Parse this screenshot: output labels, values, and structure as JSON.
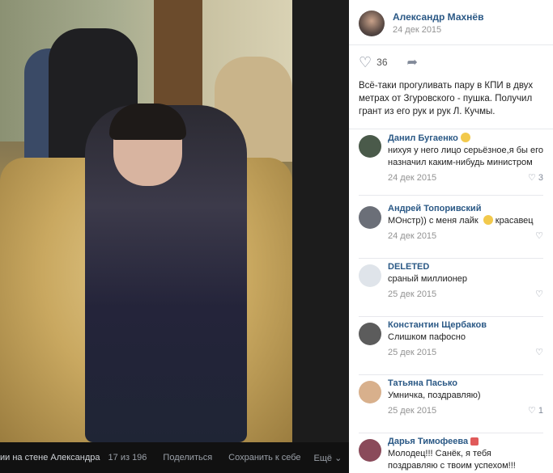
{
  "viewer": {
    "album_label": "ии на стене Александра",
    "counter": "17 из 196",
    "share_label": "Поделиться",
    "save_label": "Сохранить к себе",
    "more_label": "Ещё ⌄"
  },
  "post": {
    "author_name": "Александр Махнёв",
    "date": "24 дек 2015",
    "likes_count": "36",
    "text": "Всё-таки прогуливать пару в КПИ в двух метрах от Згуровского - пушка. Получил грант из его рук и рук Л. Кучмы."
  },
  "comments": [
    {
      "name": "Данил Бугаенко",
      "emoji": "sunglasses-emoji",
      "text": "нихуя у него лицо серьёзное,я бы его назначил каким-нибудь министром",
      "date": "24 дек 2015",
      "likes": "3"
    },
    {
      "name": "Андрей Топоривский",
      "text_before": "МОнстр)) с меня лайк",
      "text_after": "красавец",
      "date": "24 дек 2015",
      "likes": ""
    },
    {
      "name": "DELETED",
      "text": "сраный миллионер",
      "date": "25 дек 2015",
      "likes": ""
    },
    {
      "name": "Константин Щербаков",
      "text": "Слишком пафосно",
      "date": "25 дек 2015",
      "likes": ""
    },
    {
      "name": "Татьяна Пасько",
      "text": "Умничка, поздравляю)",
      "date": "25 дек 2015",
      "likes": "1"
    },
    {
      "name": "Дарья Тимофеева",
      "emoji": "pencil-emoji",
      "text": "Молодец!!! Санёк, я тебя поздравляю с твоим успехом!!!",
      "date": "",
      "likes": ""
    }
  ],
  "colors": {
    "link": "#2a5885",
    "muted": "#939393",
    "viewer_bg": "#1c1c1c"
  }
}
